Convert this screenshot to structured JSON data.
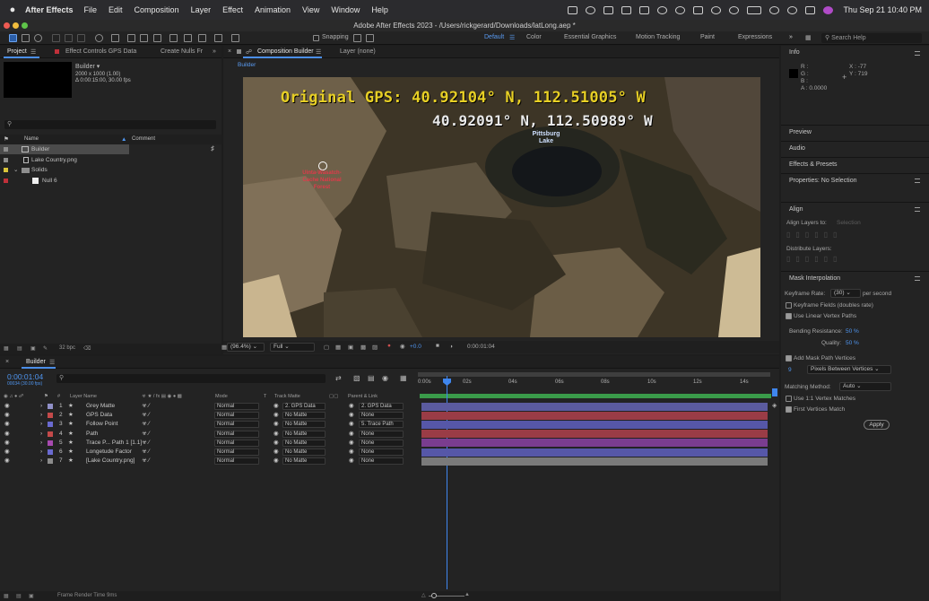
{
  "menubar": {
    "app": "After Effects",
    "items": [
      "File",
      "Edit",
      "Composition",
      "Layer",
      "Effect",
      "Animation",
      "View",
      "Window",
      "Help"
    ],
    "clock": "Thu Sep 21  10:40 PM"
  },
  "window": {
    "title": "Adobe After Effects 2023 - /Users/rickgerard/Downloads/latLong.aep *"
  },
  "toolbar": {
    "snapping": "Snapping",
    "workspaces": [
      "Default",
      "Color",
      "Essential Graphics",
      "Motion Tracking",
      "Paint",
      "Expressions"
    ],
    "search_placeholder": "Search Help"
  },
  "project": {
    "tabs": [
      "Project",
      "Effect Controls GPS Data",
      "Create Nulls Fr"
    ],
    "comp_name": "Builder ▾",
    "comp_size": "2000 x 1000 (1.00)",
    "comp_duration": "Δ 0:00:15:00, 30.00 fps",
    "col_name": "Name",
    "col_comment": "Comment",
    "items": [
      {
        "name": "Builder",
        "color": "#8c8c8c"
      },
      {
        "name": "Lake Country.png",
        "color": "#8c8c8c"
      },
      {
        "name": "Solids",
        "color": "#d8c43a"
      },
      {
        "name": "Null 6",
        "color": "#c0303a"
      }
    ],
    "bpc": "32 bpc"
  },
  "comp": {
    "tab": "Composition Builder",
    "layer_tab": "Layer (none)",
    "breadcrumb": "Builder",
    "gps_original": "Original GPS: 40.92104° N, 112.51005° W",
    "gps_current": "40.92091° N, 112.50989° W",
    "lake_label": "Pittsburg Lake",
    "forest_label": "Uinta-Wasatch-Cache National Forest",
    "zoom": "(96.4%)",
    "resolution": "Full",
    "exposure": "+0.0",
    "timecode": "0:00:01:04"
  },
  "right": {
    "info": "Info",
    "r": "R :",
    "g": "G :",
    "b": "B :",
    "a": "A :  0.0000",
    "x": "X :  -77",
    "y": "Y :  719",
    "preview": "Preview",
    "audio": "Audio",
    "effects_presets": "Effects & Presets",
    "properties": "Properties: No Selection",
    "align": "Align",
    "align_to": "Align Layers to:",
    "align_selection": "Selection",
    "distribute": "Distribute Layers:",
    "mask_interp": "Mask Interpolation",
    "keyframe_rate": "Keyframe Rate:",
    "keyframe_rate_val": "(30)",
    "per_second": "per second",
    "keyframe_fields": "Keyframe Fields (doubles rate)",
    "linear_vertex": "Use Linear Vertex Paths",
    "bending": "Bending Resistance:",
    "bending_val": "50 %",
    "quality": "Quality:",
    "quality_val": "50 %",
    "add_mask": "Add Mask Path Vertices",
    "vertices_val": "9",
    "pixels_between": "Pixels Between Vertices",
    "matching": "Matching Method:",
    "matching_val": "Auto",
    "use_1_1": "Use 1:1 Vertex Matches",
    "first_vertices": "First Vertices Match",
    "apply": "Apply"
  },
  "timeline": {
    "tab": "Builder",
    "time": "0:00:01:04",
    "frames": "00034 (30.00 fps)",
    "columns": {
      "layer_name": "Layer Name",
      "mode": "Mode",
      "t": "T",
      "track_matte": "Track Matte",
      "parent": "Parent & Link"
    },
    "ticks": [
      "0:00s",
      "02s",
      "04s",
      "06s",
      "08s",
      "10s",
      "12s",
      "14s"
    ],
    "layers": [
      {
        "num": "1",
        "name": "Grey Matte",
        "mode": "Normal",
        "matte": "2. GPS Data",
        "parent": "2. GPS Data",
        "color": "#9090c8",
        "bar": "#5b5b9f"
      },
      {
        "num": "2",
        "name": "GPS Data",
        "mode": "Normal",
        "matte": "No Matte",
        "parent": "None",
        "color": "#c44a4a",
        "bar": "#9a3c46"
      },
      {
        "num": "3",
        "name": "Follow Point",
        "mode": "Normal",
        "matte": "No Matte",
        "parent": "5. Trace Path",
        "color": "#6a6ad0",
        "bar": "#5657a8"
      },
      {
        "num": "4",
        "name": "Path",
        "mode": "Normal",
        "matte": "No Matte",
        "parent": "None",
        "color": "#c44a4a",
        "bar": "#9a3c46"
      },
      {
        "num": "5",
        "name": "Trace P... Path 1 [1.1]",
        "mode": "Normal",
        "matte": "No Matte",
        "parent": "None",
        "color": "#a84ab0",
        "bar": "#7a3d8f"
      },
      {
        "num": "6",
        "name": "Longetude Factor",
        "mode": "Normal",
        "matte": "No Matte",
        "parent": "None",
        "color": "#6a6ad0",
        "bar": "#5657a8"
      },
      {
        "num": "7",
        "name": "[Lake Country.png]",
        "mode": "Normal",
        "matte": "No Matte",
        "parent": "None",
        "color": "#8c8c8c",
        "bar": "#7a7a7a"
      }
    ],
    "footer": "Frame Render Time  9ms"
  }
}
